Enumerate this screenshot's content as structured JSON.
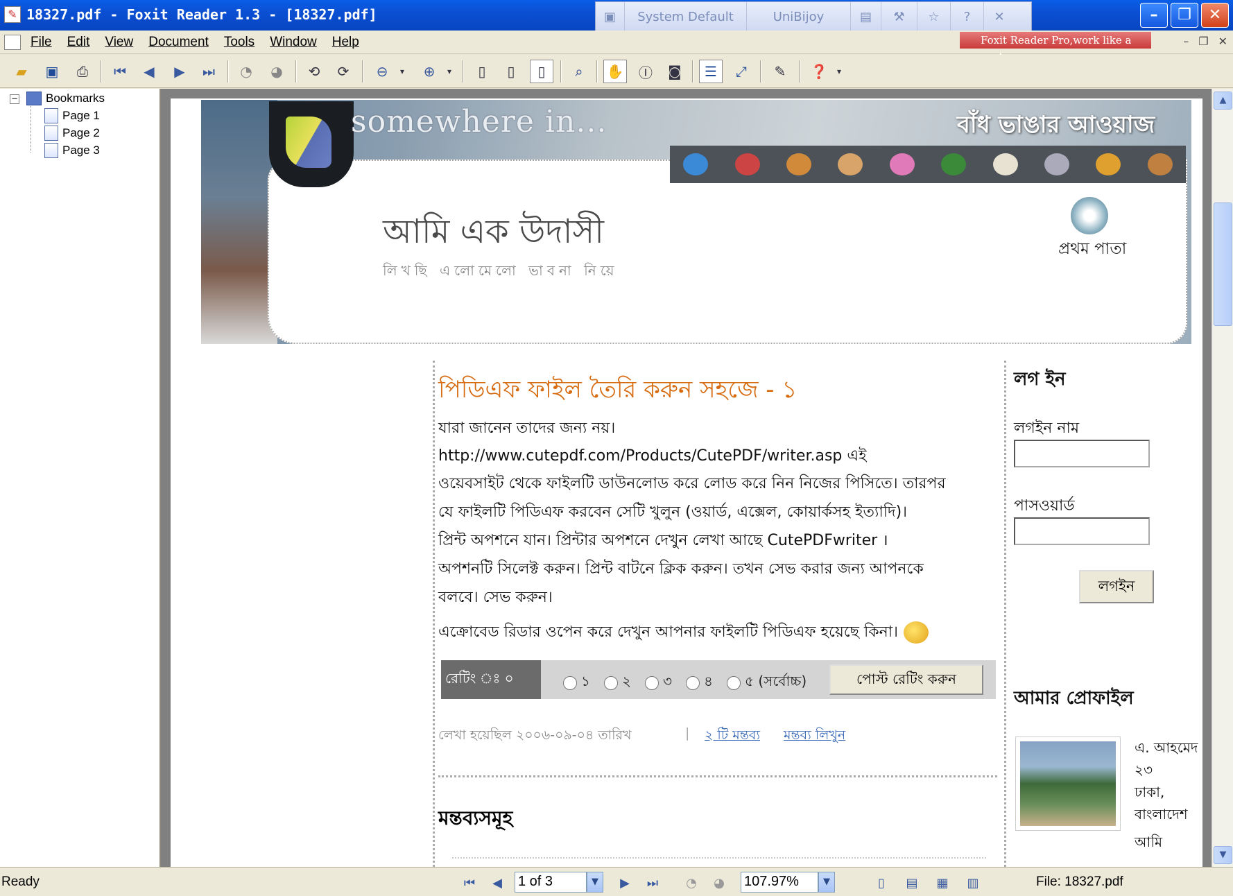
{
  "window": {
    "title": "18327.pdf - Foxit Reader 1.3 - [18327.pdf]",
    "ime": {
      "keyboard": "System Default",
      "layout": "UniBijoy"
    },
    "promo": "Foxit Reader Pro,work like a pro!"
  },
  "menu": [
    "File",
    "Edit",
    "View",
    "Document",
    "Tools",
    "Window",
    "Help"
  ],
  "bookmarks": {
    "root": "Bookmarks",
    "items": [
      "Page 1",
      "Page 2",
      "Page 3"
    ]
  },
  "doc": {
    "brand": "somewhere in...",
    "tagline": "বাঁধ ভাঙার আওয়াজ",
    "blog_title": "আমি এক উদাসী",
    "blog_subtitle": "লিখছি এলোমেলো ভাবনা নিয়ে",
    "home_label": "প্রথম পাতা",
    "post": {
      "title": "পিডিএফ ফাইল তৈরি করুন সহজে - ১",
      "lines": [
        "যারা জানেন তাদের জন্য নয়।",
        "http://www.cutepdf.com/Products/CutePDF/writer.asp এই",
        "ওয়েবসাইট থেকে ফাইলটি ডাউনলোড করে লোড করে নিন নিজের পিসিতে। তারপর",
        "যে ফাইলটি পিডিএফ করবেন সেটি খুলুন (ওয়ার্ড, এক্সেল, কোয়ার্কসহ ইত্যাদি)।",
        "প্রিন্ট অপশনে যান। প্রিন্টার অপশনে দেখুন লেখা আছে CutePDFwriter ।",
        "অপশনটি সিলেক্ট করুন। প্রিন্ট বাটনে ক্লিক করুন। তখন সেভ করার জন্য আপনকে",
        "বলবে। সেভ করুন।",
        "এক্রোবেড রিডার ওপেন করে দেখুন আপনার ফাইলটি পিডিএফ হয়েছে কিনা।"
      ],
      "rating_label": "রেটিং ঃ ০",
      "rating_options": [
        "১",
        "২",
        "৩",
        "৪",
        "৫ (সর্বোচ্চ)"
      ],
      "post_rating_button": "পোস্ট রেটিং করুন",
      "meta": "লেখা হয়েছিল ২০০৬-০৯-০৪ তারিখ",
      "meta_sep": "|",
      "comments_link": "২ টি মন্তব্য",
      "write_comment_link": "মন্তব্য লিখুন",
      "comments_heading": "মন্তব্যসমূহ"
    },
    "sidebar": {
      "login_heading": "লগ ইন",
      "username_label": "লগইন নাম",
      "password_label": "পাসওয়ার্ড",
      "login_button": "লগইন",
      "profile_heading": "আমার প্রোফাইল",
      "profile_lines": [
        "এ. আহমেদ",
        "২৩",
        "ঢাকা,",
        "বাংলাদেশ",
        "আমি"
      ]
    }
  },
  "status": {
    "text": "Ready",
    "page": "1 of 3",
    "zoom": "107.97%",
    "file": "File: 18327.pdf"
  }
}
